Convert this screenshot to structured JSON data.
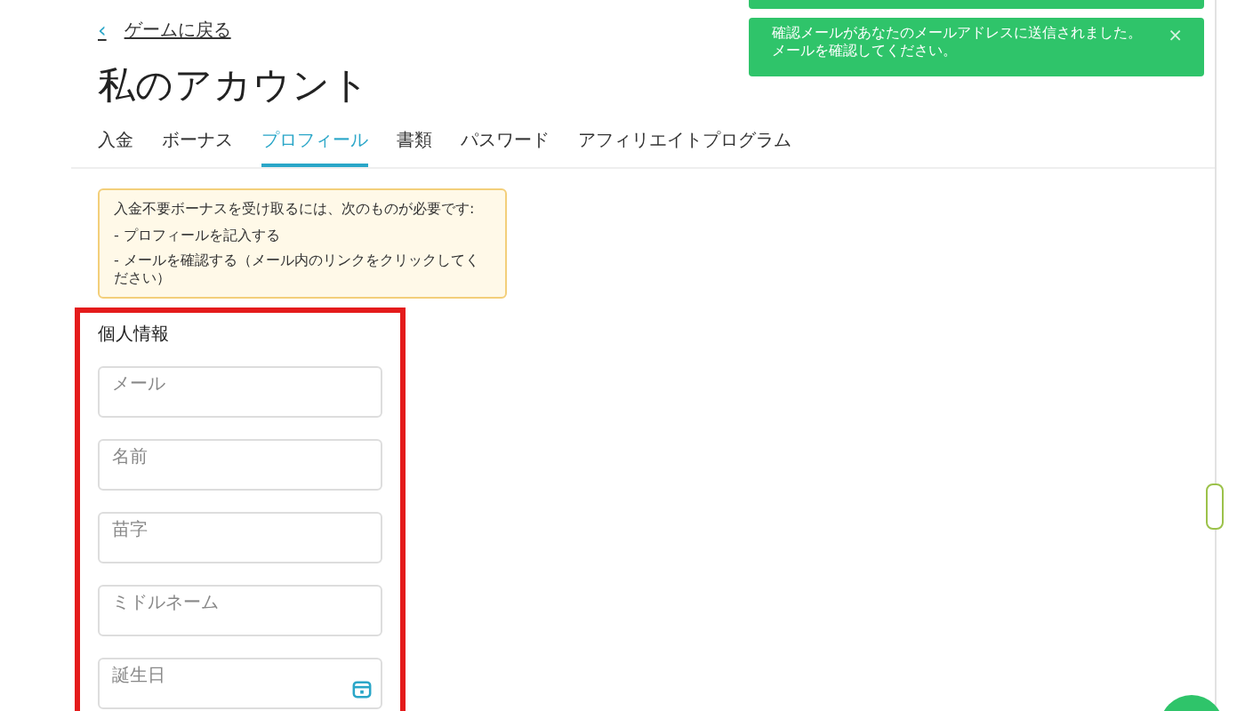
{
  "back_link": {
    "icon": "‹",
    "label": "ゲームに戻る"
  },
  "title": "私のアカウント",
  "tabs": [
    {
      "label": "入金",
      "selected": false
    },
    {
      "label": "ボーナス",
      "selected": false
    },
    {
      "label": "プロフィール",
      "selected": true
    },
    {
      "label": "書類",
      "selected": false
    },
    {
      "label": "パスワード",
      "selected": false
    },
    {
      "label": "アフィリエイトプログラム",
      "selected": false
    }
  ],
  "notice": {
    "intro": "入金不要ボーナスを受け取るには、次のものが必要です:",
    "items": [
      "- プロフィールを記入する",
      "- メールを確認する（メール内のリンクをクリックしてください）"
    ]
  },
  "personal_info": {
    "heading": "個人情報",
    "highlighted": true,
    "fields": [
      {
        "label": "メール",
        "kind": "text"
      },
      {
        "label": "名前",
        "kind": "text"
      },
      {
        "label": "苗字",
        "kind": "text"
      },
      {
        "label": "ミドルネーム",
        "kind": "text"
      },
      {
        "label": "誕生日",
        "kind": "date"
      }
    ]
  },
  "toast": {
    "message": "確認メールがあなたのメールアドレスに送信されました。メールを確認してください。",
    "close": "×"
  }
}
